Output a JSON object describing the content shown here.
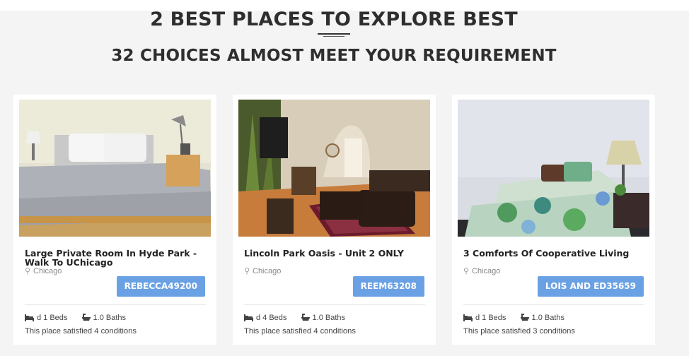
{
  "header": {
    "title": "2 BEST PLACES TO EXPLORE BEST",
    "subtitle": "32 CHOICES ALMOST MEET YOUR REQUIREMENT"
  },
  "listings": [
    {
      "title": "Large Private Room In Hyde Park - Walk To UChicago",
      "location": "Chicago",
      "host": "REBECCA49200",
      "beds": "d 1 Beds",
      "baths": "1.0 Baths",
      "conditions": "This place satisfied 4 conditions"
    },
    {
      "title": "Lincoln Park Oasis - Unit 2 ONLY",
      "location": "Chicago",
      "host": "REEM63208",
      "beds": "d 4 Beds",
      "baths": "1.0 Baths",
      "conditions": "This place satisfied 4 conditions"
    },
    {
      "title": "3 Comforts Of Cooperative Living",
      "location": "Chicago",
      "host": "LOIS AND ED35659",
      "beds": "d 1 Beds",
      "baths": "1.0 Baths",
      "conditions": "This place satisfied 3 conditions"
    }
  ],
  "icons": {
    "location": "map-pin-icon",
    "beds": "bed-icon",
    "baths": "bathtub-icon"
  },
  "colors": {
    "button": "#6aa1e4",
    "background": "#f4f4f4",
    "card": "#ffffff"
  }
}
